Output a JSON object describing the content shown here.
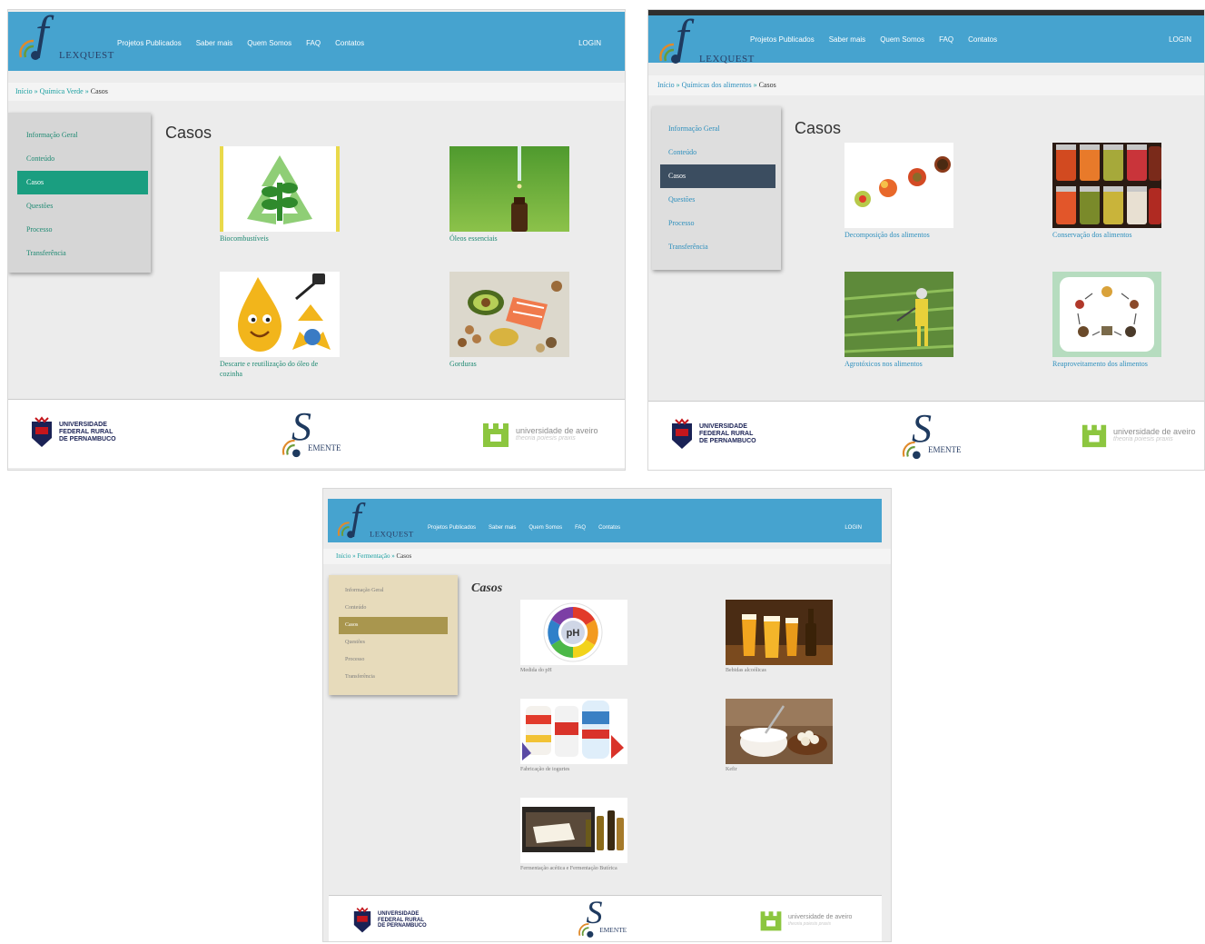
{
  "brand": {
    "logo_text": "LEXQUEST"
  },
  "nav": {
    "items": [
      "Projetos Publicados",
      "Saber mais",
      "Quem Somos",
      "FAQ",
      "Contatos"
    ],
    "login": "LOGIN"
  },
  "page_title": "Casos",
  "menu": [
    "Informação Geral",
    "Conteúdo",
    "Casos",
    "Questões",
    "Processo",
    "Transferência"
  ],
  "colors": {
    "header": "#46a3cf",
    "menu_active_1": "#1a9e80",
    "menu_active_2": "#3b4d60",
    "menu_active_3": "#a9964e"
  },
  "footer": {
    "ufrpe": [
      "UNIVERSIDADE",
      "FEDERAL RURAL",
      "DE PERNAMBUCO"
    ],
    "emente": "EMENTE",
    "aveiro_name": "universidade de aveiro",
    "aveiro_motto": "theoria poiesis praxis"
  },
  "screens": [
    {
      "breadcrumb": {
        "home": "Início",
        "section": "Química Verde",
        "current": "Casos"
      },
      "cases": [
        {
          "label": "Biocombustíveis",
          "icon": "biofuel-recycle-image"
        },
        {
          "label": "Óleos essenciais",
          "icon": "essential-oil-dropper-image"
        },
        {
          "label": "Descarte e reutilização do óleo de cozinha",
          "icon": "oil-drop-recycle-image"
        },
        {
          "label": "Gorduras",
          "icon": "fatty-foods-image"
        }
      ]
    },
    {
      "breadcrumb": {
        "home": "Início",
        "section": "Químicas dos alimentos",
        "current": "Casos"
      },
      "cases": [
        {
          "label": "Decomposição dos alimentos",
          "icon": "decaying-apples-image"
        },
        {
          "label": "Conservação dos alimentos",
          "icon": "preserves-jars-image"
        },
        {
          "label": "Agrotóxicos nos alimentos",
          "icon": "pesticide-spraying-image"
        },
        {
          "label": "Reaproveitamento dos alimentos",
          "icon": "food-cycle-image"
        }
      ]
    },
    {
      "breadcrumb": {
        "home": "Início",
        "section": "Fermentação",
        "current": "Casos"
      },
      "cases": [
        {
          "label": "Medida do pH",
          "icon": "ph-scale-wheel-image"
        },
        {
          "label": "Bebidas alcoólicas",
          "icon": "beer-glasses-image"
        },
        {
          "label": "Fabricação de iogurtes",
          "icon": "yogurt-bottles-image"
        },
        {
          "label": "Kefir",
          "icon": "kefir-grains-image"
        },
        {
          "label": "Fermentação acética e Fermentação Butírica",
          "icon": "vinegar-cheese-image"
        }
      ]
    }
  ]
}
